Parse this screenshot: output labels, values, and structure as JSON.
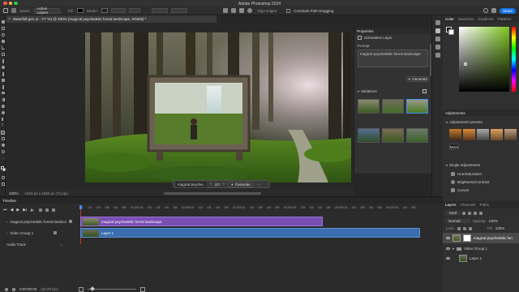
{
  "app": {
    "title": "Adobe Photoshop 2024",
    "share_label": "Share",
    "traffic_lights": [
      "#ff5f57",
      "#febc2e",
      "#28c840"
    ]
  },
  "options_bar": {
    "select_label": "Select:",
    "select_value": "Active Layers",
    "fill_label": "Fill:",
    "stroke_label": "Stroke:",
    "align_edges": "Align Edges",
    "constrain_label": "Constrain Path Dragging"
  },
  "document": {
    "tab_title": "Waterfall gen ai - YT Tut @ 100% (magical psychedelic forest landscape, RGB/8) *",
    "zoom": "100%",
    "doc_info": "1920 px x 1080 px (72 ppi)"
  },
  "context_bar": {
    "prompt": "magical psyche...",
    "counter": "2/3",
    "generate_label": "Generate",
    "more": "···"
  },
  "properties": {
    "title": "Properties",
    "layer_type": "Generative Layer",
    "prompt_label": "Prompt",
    "prompt_text": "magical psychedelic forest landscape",
    "generate_label": "Generate",
    "variations_label": "Variations"
  },
  "right_tabs": {
    "color_tabs": [
      "Color",
      "Swatches",
      "Gradients",
      "Patterns"
    ],
    "adjustments_title": "Adjustments",
    "presets_label": "Adjustments presets",
    "more_label": "More",
    "single_label": "Single adjustments",
    "single_items": [
      "Hue/Saturation",
      "Brightness/Contrast",
      "Curves"
    ]
  },
  "layers_panel": {
    "tabs": [
      "Layers",
      "Channels",
      "Paths"
    ],
    "kind_label": "Kind",
    "blend_mode": "Normal",
    "opacity_label": "Opacity:",
    "opacity_value": "100%",
    "lock_label": "Lock:",
    "fill_label": "Fill:",
    "fill_value": "100%",
    "layers": [
      {
        "name": "magical psychedelic forest landscape",
        "selected": true
      },
      {
        "name": "Video Group 1",
        "selected": false
      },
      {
        "name": "Layer 1",
        "selected": false
      }
    ]
  },
  "timeline": {
    "title": "Timeline",
    "ruler_marks": [
      "00",
      "01f",
      "02f",
      "03f",
      "04f",
      "05f",
      "01:00f",
      "01f",
      "02f",
      "03f",
      "04f",
      "05f",
      "02:00f",
      "01f",
      "02f",
      "03f",
      "04f",
      "05f",
      "03:00f",
      "01f",
      "02f",
      "03f",
      "04f",
      "05f",
      "04:00f",
      "01f",
      "02f",
      "03f",
      "04f",
      "05f",
      "05:00f",
      "01f",
      "02f",
      "03f",
      "04f",
      "05f",
      "06:00f",
      "01f",
      "02f",
      "03f"
    ],
    "tracks": [
      {
        "label": "magical psychedelic forest landscape",
        "clip": "magical psychedelic forest landscape",
        "color": "#7a4fb4"
      },
      {
        "label": "Video Group 1",
        "clip": "Layer 1",
        "color": "#3a6eb0"
      },
      {
        "label": "Audio Track",
        "clip": "",
        "color": ""
      }
    ],
    "timecode": "0:00:00:00",
    "fps": "(30.00 fps)"
  }
}
